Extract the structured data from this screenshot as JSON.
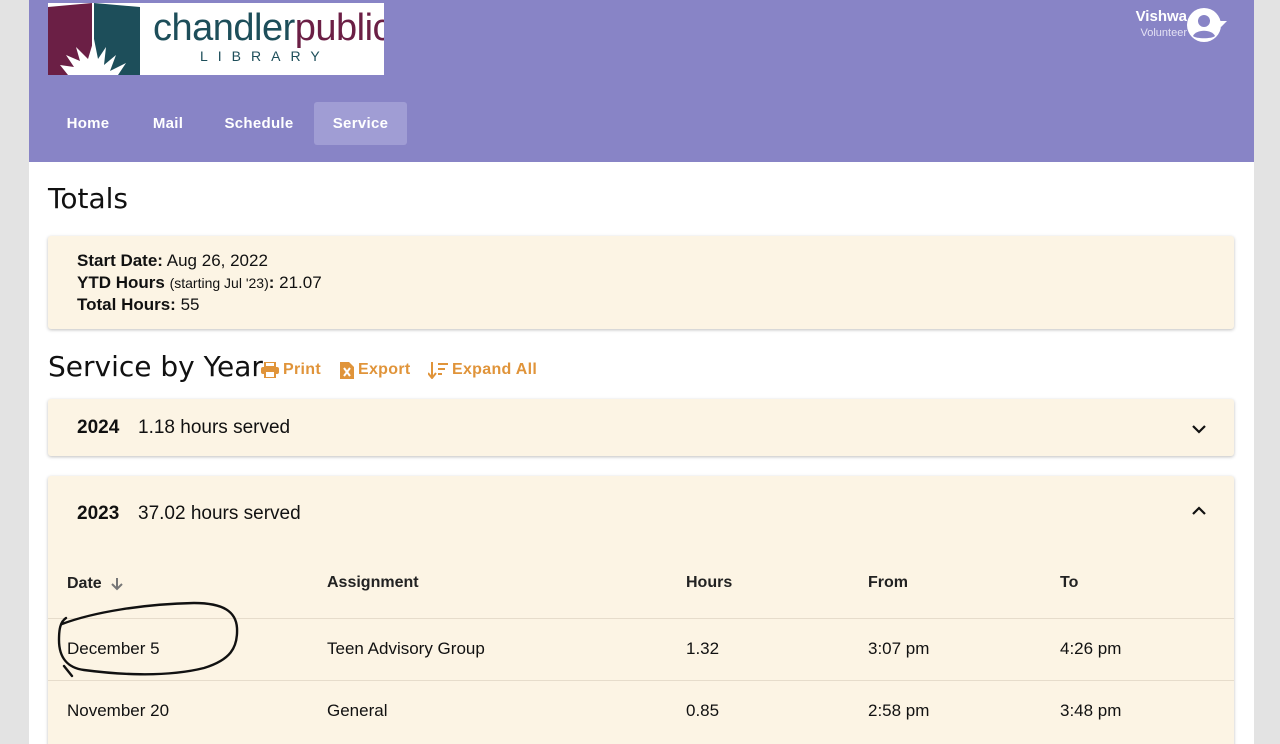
{
  "logo": {
    "name_part1": "chandler",
    "name_part2": "public",
    "sub": "LIBRARY"
  },
  "user": {
    "name": "Vishwa",
    "role": "Volunteer"
  },
  "nav": {
    "items": [
      "Home",
      "Mail",
      "Schedule",
      "Service"
    ],
    "active": "Service"
  },
  "totals": {
    "heading": "Totals",
    "start_label": "Start Date:",
    "start_value": "Aug 26, 2022",
    "ytd_label": "YTD Hours",
    "ytd_note": "(starting Jul '23)",
    "ytd_colon": ":",
    "ytd_value": "21.07",
    "total_label": "Total Hours:",
    "total_value": "55"
  },
  "service": {
    "heading": "Service by Year",
    "actions": {
      "print": "Print",
      "export": "Export",
      "expand": "Expand All"
    },
    "years": [
      {
        "year": "2024",
        "hours_text": "1.18 hours served",
        "expanded": false
      },
      {
        "year": "2023",
        "hours_text": "37.02 hours served",
        "expanded": true
      }
    ],
    "table": {
      "headers": {
        "date": "Date",
        "assignment": "Assignment",
        "hours": "Hours",
        "from": "From",
        "to": "To"
      },
      "rows": [
        {
          "date": "December 5",
          "assignment": "Teen Advisory Group",
          "hours": "1.32",
          "from": "3:07 pm",
          "to": "4:26 pm"
        },
        {
          "date": "November 20",
          "assignment": "General",
          "hours": "0.85",
          "from": "2:58 pm",
          "to": "3:48 pm"
        }
      ]
    }
  },
  "colors": {
    "header": "#8884c6",
    "accent": "#e0943a",
    "card": "#fcf4e4"
  }
}
